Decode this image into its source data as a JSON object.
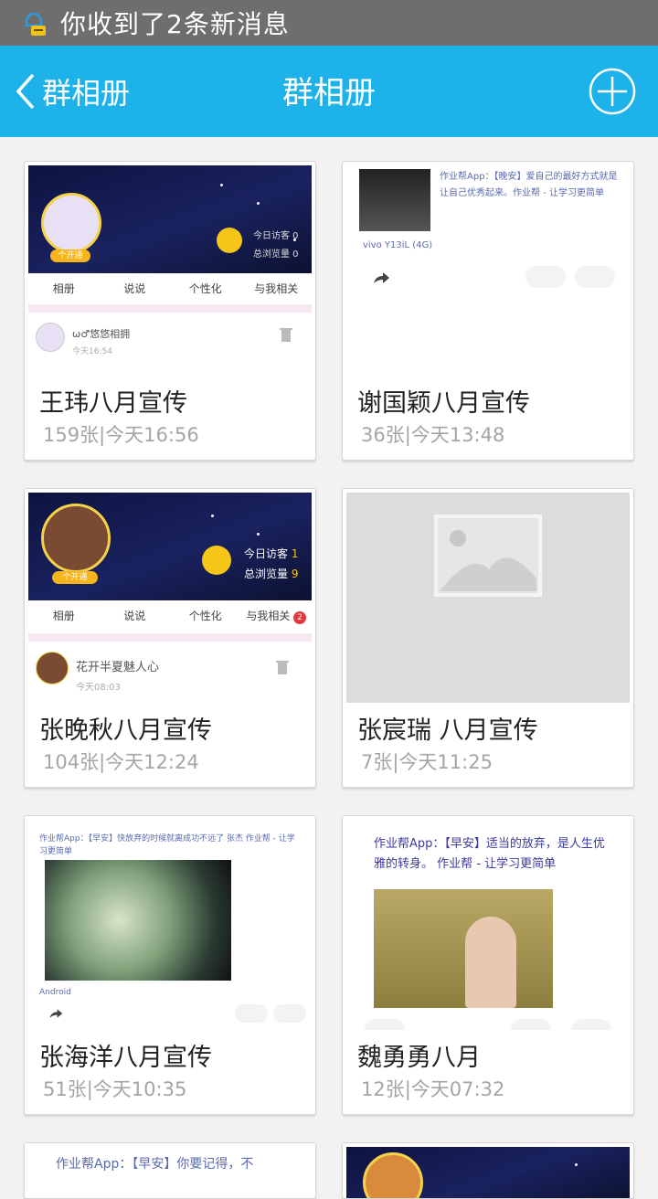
{
  "status_bar": {
    "notification": "你收到了2条新消息"
  },
  "header": {
    "back_label": "群相册",
    "title": "群相册"
  },
  "albums": [
    {
      "name": "王玮八月宣传",
      "meta": "159张|今天16:56"
    },
    {
      "name": "谢国颖八月宣传",
      "meta": "36张|今天13:48"
    },
    {
      "name": "张晚秋八月宣传",
      "meta": "104张|今天12:24"
    },
    {
      "name": "张宸瑞 八月宣传",
      "meta": "7张|今天11:25"
    },
    {
      "name": "张海洋八月宣传",
      "meta": "51张|今天10:35"
    },
    {
      "name": "魏勇勇八月",
      "meta": "12张|今天07:32"
    }
  ],
  "thumbs": {
    "t1": {
      "visit_today": "今日访客 0",
      "visit_total": "总浏览量 0",
      "tabs": [
        "相册",
        "说说",
        "个性化",
        "与我相关"
      ],
      "user": "ω♂悠悠相拥",
      "time": "今天16:54",
      "badge": "个开通"
    },
    "t2": {
      "post": "作业帮App：【晚安】爱自己的最好方式就是让自己优秀起来。作业帮 - 让学习更简单",
      "device": "vivo Y13iL (4G)"
    },
    "t3": {
      "visit_today": "今日访客",
      "visit_today_n": "1",
      "visit_total": "总浏览量",
      "visit_total_n": "9",
      "tabs": [
        "相册",
        "说说",
        "个性化",
        "与我相关"
      ],
      "badge_count": "2",
      "user": "花开半夏魅人心",
      "time": "今天08:03",
      "open": "个开通"
    },
    "t5": {
      "post": "作业帮App：【早安】快放弃的时候就离成功不远了 张杰 作业帮 - 让学习更简单",
      "device": "Android"
    },
    "t6": {
      "post": "作业帮App：【早安】适当的放弃，是人生优雅的转身。 作业帮 - 让学习更简单"
    },
    "t7": {
      "post": "作业帮App：【早安】你要记得，不"
    }
  }
}
